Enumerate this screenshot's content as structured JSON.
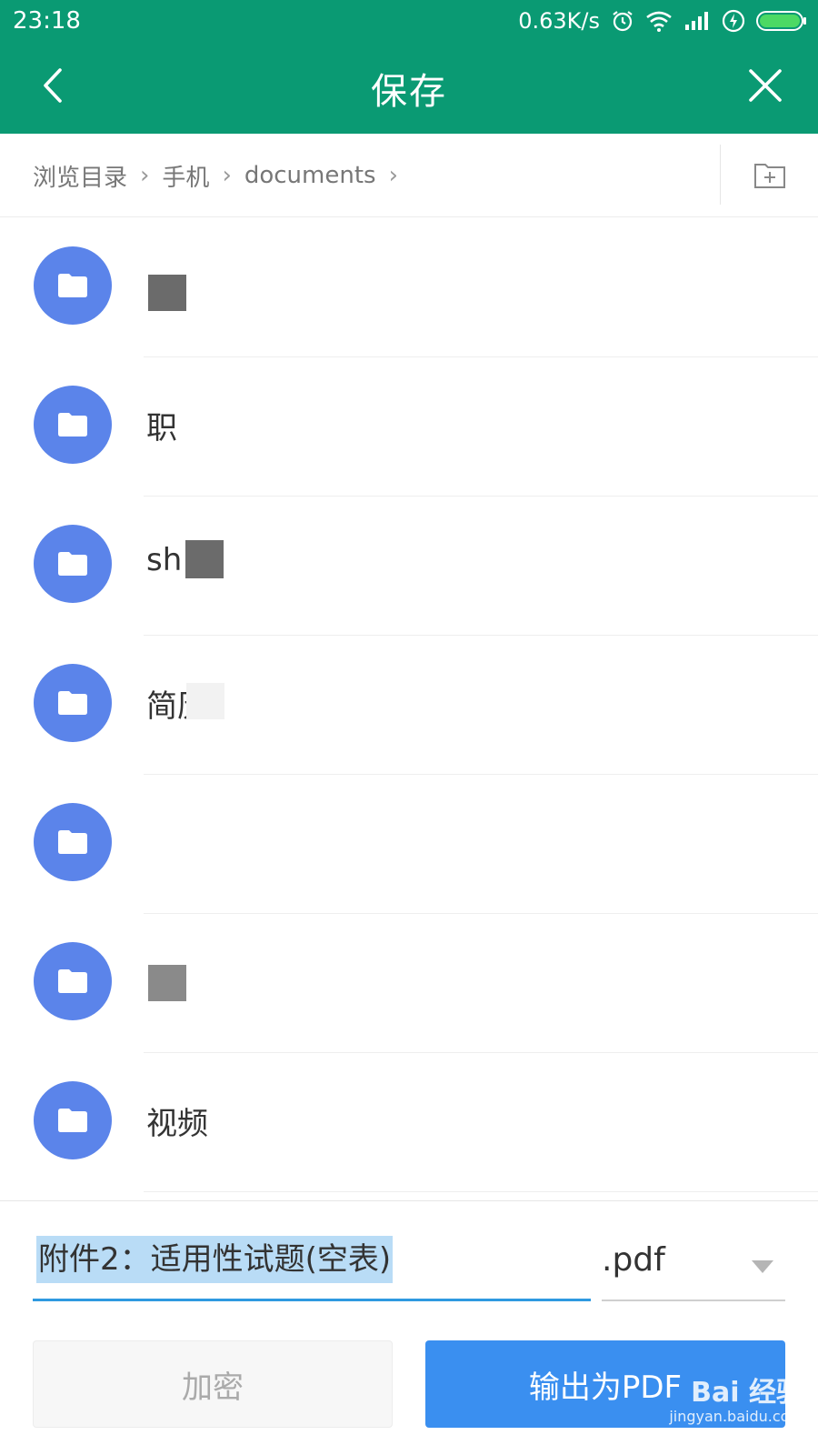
{
  "status_bar": {
    "time": "23:18",
    "net_speed": "0.63K/s",
    "icons": [
      "alarm-icon",
      "wifi-icon",
      "signal-icon",
      "charging-icon",
      "battery-icon"
    ]
  },
  "header": {
    "title": "保存",
    "back_icon": "chevron-left-icon",
    "close_icon": "close-icon",
    "background_color": "#0a9a73"
  },
  "breadcrumb": {
    "items": [
      "浏览目录",
      "手机",
      "documents"
    ],
    "separator": "›",
    "new_folder_icon": "new-folder-icon"
  },
  "folders": [
    {
      "name": "",
      "icon": "folder-icon"
    },
    {
      "name": "职",
      "icon": "folder-icon"
    },
    {
      "name": "sh",
      "icon": "folder-icon"
    },
    {
      "name": "简历",
      "icon": "folder-icon"
    },
    {
      "name": "",
      "icon": "folder-icon"
    },
    {
      "name": "",
      "icon": "folder-icon"
    },
    {
      "name": "视频",
      "icon": "folder-icon"
    }
  ],
  "save_form": {
    "filename_value": "附件2：适用性试题(空表)",
    "extension_selected": ".pdf",
    "encrypt_label": "加密",
    "export_label": "输出为PDF",
    "accent_color": "#3a8ff0"
  },
  "watermark": {
    "brand": "Bai 经验",
    "url": "jingyan.baidu.com"
  }
}
